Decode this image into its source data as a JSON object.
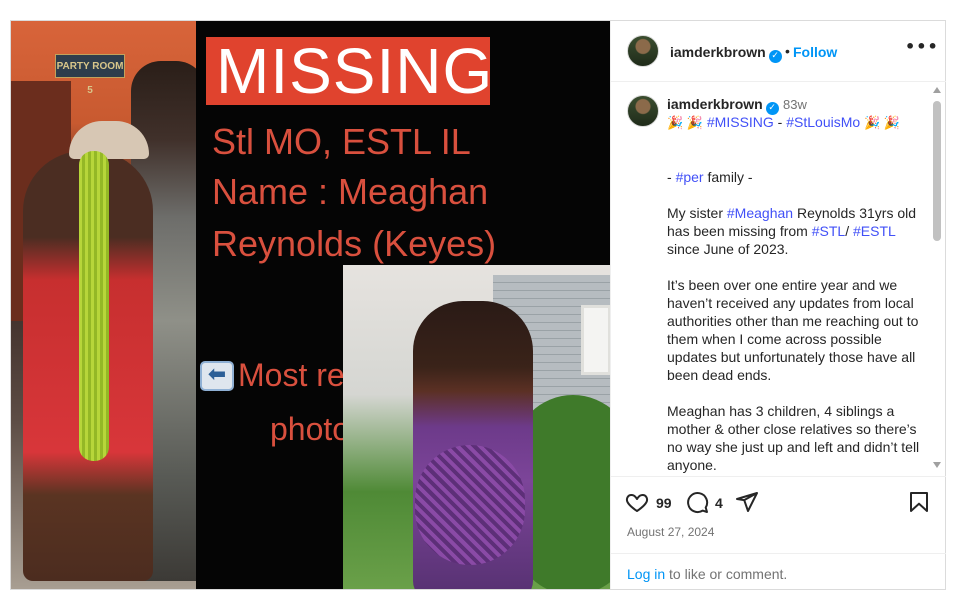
{
  "post": {
    "image": {
      "sign_text": "PARTY ROOM 5",
      "missing_label": "MISSING",
      "line1": "Stl MO, ESTL IL",
      "line2": "Name : Meaghan",
      "line3": "Reynolds (Keyes)",
      "arrow_glyph": "⬅",
      "recent_line1": "Most recent",
      "recent_line2": "photo"
    },
    "header": {
      "username": "iamderkbrown",
      "separator": "•",
      "follow_label": "Follow",
      "more_glyph": "•••"
    },
    "caption": {
      "username": "iamderkbrown",
      "age": "83w",
      "line1_emoji_left": "🎉 🎉",
      "tag_missing": "#MISSING",
      "line1_dash": " - ",
      "tag_stlouismo": "#StLouisMo",
      "line1_emoji_right": "🎉 🎉",
      "p1_prefix": "- ",
      "tag_per": "#per",
      "p1_suffix": " family -",
      "p2_a": "My sister ",
      "tag_meaghan": "#Meaghan",
      "p2_b": " Reynolds 31yrs old has been missing from ",
      "tag_stl": "#STL",
      "p2_c": "/ ",
      "tag_estl": "#ESTL",
      "p2_d": " since June of 2023.",
      "p3": "It’s been over one entire year and we haven’t received any updates from local authorities other than me reaching out to them when I come across possible updates but unfortunately those have all been dead ends.",
      "p4": "Meaghan has 3 children, 4 siblings a mother & other close relatives so there’s no way she just up and left and didn’t tell anyone."
    },
    "actions": {
      "likes": "99",
      "comments": "4",
      "date": "August 27, 2024",
      "login_link": "Log in",
      "login_rest": " to like or comment."
    },
    "colors": {
      "accent": "#0095f6",
      "missing_bg": "#e0432e",
      "poster_text": "#d9503e",
      "hashtag": "#4150f7"
    }
  }
}
